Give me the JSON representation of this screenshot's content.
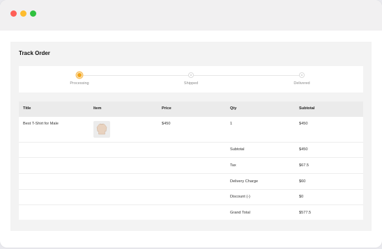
{
  "window": {
    "controls": [
      "close",
      "minimize",
      "maximize"
    ]
  },
  "page": {
    "title": "Track Order"
  },
  "tracker": {
    "steps": [
      {
        "label": "Processing",
        "state": "active"
      },
      {
        "label": "Shipped",
        "state": "pending"
      },
      {
        "label": "Delivered",
        "state": "pending"
      }
    ],
    "accent_color": "#f2a51a"
  },
  "table": {
    "columns": [
      "Title",
      "Item",
      "Price",
      "Qty",
      "Subtotal"
    ],
    "item_row": {
      "title": "Best T-Shirt for Male",
      "image": "sweatshirt-thumbnail",
      "price": "$450",
      "qty": "1",
      "subtotal": "$450"
    },
    "summary": [
      {
        "label": "Subtotal",
        "value": "$450"
      },
      {
        "label": "Tax",
        "value": "$67.5"
      },
      {
        "label": "Delivery Charge",
        "value": "$60"
      },
      {
        "label": "Discount (-)",
        "value": "$0"
      },
      {
        "label": "Grand Total",
        "value": "$577.5"
      }
    ]
  }
}
